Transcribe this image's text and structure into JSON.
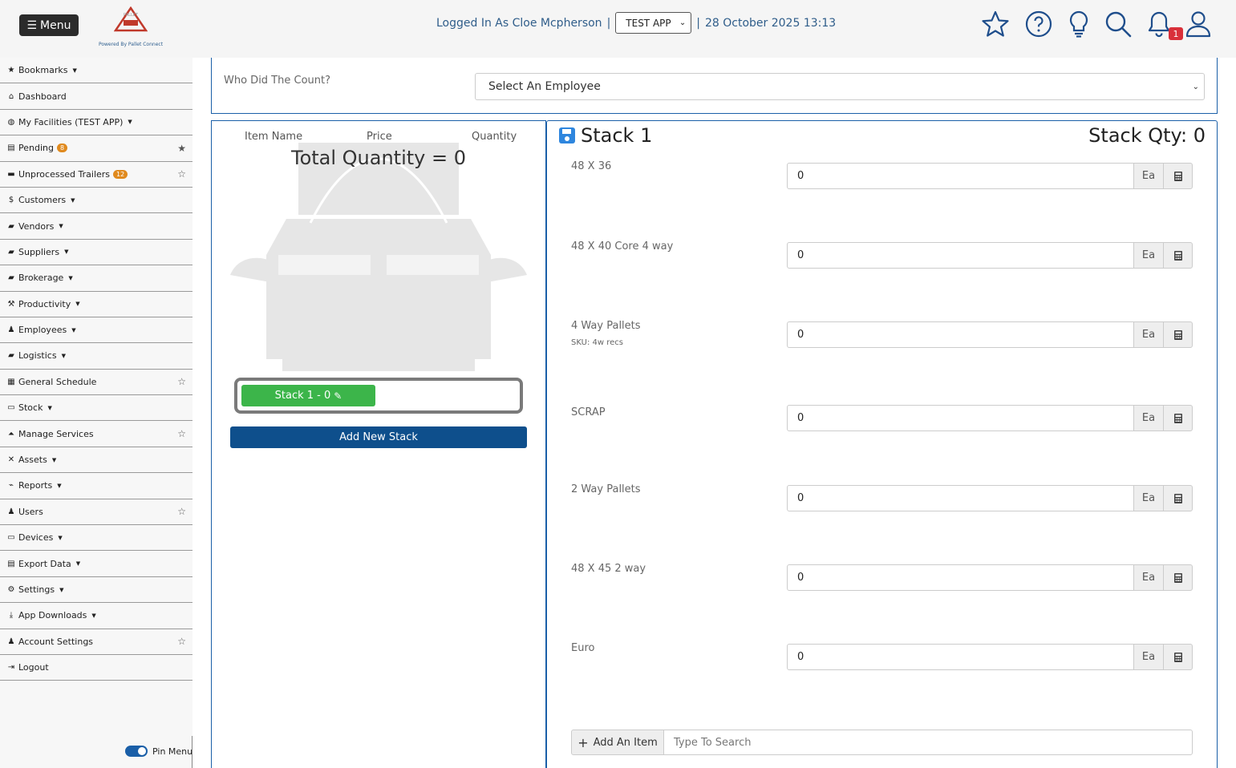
{
  "header": {
    "menu_label": "Menu",
    "logo_sub": "Powered By Pallet Connect",
    "logged_in_text": "Logged In As Cloe Mcpherson",
    "separator": "|",
    "app_select": "TEST APP",
    "datetime": "28 October 2025 13:13",
    "notification_count": "1"
  },
  "sidebar": {
    "items": [
      {
        "label": "Bookmarks",
        "icon": "star-icon",
        "glyph": "★",
        "caret": true
      },
      {
        "label": "Dashboard",
        "icon": "home-icon",
        "glyph": "⌂"
      },
      {
        "label": "My Facilities (TEST APP)",
        "icon": "globe-icon",
        "glyph": "◍",
        "caret": true
      },
      {
        "label": "Pending",
        "icon": "clipboard-icon",
        "glyph": "▤",
        "badge": "8",
        "star": "★"
      },
      {
        "label": "Unprocessed Trailers",
        "icon": "trailer-icon",
        "glyph": "▬",
        "badge": "12",
        "star": "☆"
      },
      {
        "label": "Customers",
        "icon": "dollar-icon",
        "glyph": "$",
        "caret": true
      },
      {
        "label": "Vendors",
        "icon": "truck-icon",
        "glyph": "▰",
        "caret": true
      },
      {
        "label": "Suppliers",
        "icon": "truck-icon",
        "glyph": "▰",
        "caret": true
      },
      {
        "label": "Brokerage",
        "icon": "truck-fast-icon",
        "glyph": "▰",
        "caret": true
      },
      {
        "label": "Productivity",
        "icon": "hammer-icon",
        "glyph": "⚒",
        "caret": true
      },
      {
        "label": "Employees",
        "icon": "person-icon",
        "glyph": "♟",
        "caret": true
      },
      {
        "label": "Logistics",
        "icon": "truck-icon",
        "glyph": "▰",
        "caret": true
      },
      {
        "label": "General Schedule",
        "icon": "calendar-icon",
        "glyph": "▦",
        "star": "☆"
      },
      {
        "label": "Stock",
        "icon": "pallet-icon",
        "glyph": "▭",
        "caret": true
      },
      {
        "label": "Manage Services",
        "icon": "bell-service-icon",
        "glyph": "⏶",
        "star": "☆"
      },
      {
        "label": "Assets",
        "icon": "tools-icon",
        "glyph": "✕",
        "caret": true
      },
      {
        "label": "Reports",
        "icon": "chart-line-icon",
        "glyph": "⌁",
        "caret": true
      },
      {
        "label": "Users",
        "icon": "users-icon",
        "glyph": "♟",
        "star": "☆"
      },
      {
        "label": "Devices",
        "icon": "desktop-icon",
        "glyph": "▭",
        "caret": true
      },
      {
        "label": "Export Data",
        "icon": "file-export-icon",
        "glyph": "▤",
        "caret": true
      },
      {
        "label": "Settings",
        "icon": "gears-icon",
        "glyph": "⚙",
        "caret": true
      },
      {
        "label": "App Downloads",
        "icon": "download-icon",
        "glyph": "⤓",
        "caret": true
      },
      {
        "label": "Account Settings",
        "icon": "user-icon",
        "glyph": "♟",
        "star": "☆"
      },
      {
        "label": "Logout",
        "icon": "logout-icon",
        "glyph": "⇥"
      }
    ],
    "pin_menu_label": "Pin Menu"
  },
  "count": {
    "label": "Who Did The Count?",
    "employee_select": "Select An Employee"
  },
  "left_panel": {
    "col_item_name": "Item Name",
    "col_price": "Price",
    "col_quantity": "Quantity",
    "total_quantity": "Total Quantity = 0",
    "stack_pill": "Stack 1 - 0",
    "add_stack_label": "Add New Stack"
  },
  "right_panel": {
    "stack_title": "Stack 1",
    "stack_qty": "Stack Qty: 0",
    "items": [
      {
        "name": "48 X 36",
        "sku": "",
        "value": "0",
        "unit": "Ea"
      },
      {
        "name": "48 X 40 Core 4 way",
        "sku": "",
        "value": "0",
        "unit": "Ea"
      },
      {
        "name": "4 Way Pallets",
        "sku": "SKU: 4w recs",
        "value": "0",
        "unit": "Ea"
      },
      {
        "name": "SCRAP",
        "sku": "",
        "value": "0",
        "unit": "Ea"
      },
      {
        "name": "2 Way Pallets",
        "sku": "",
        "value": "0",
        "unit": "Ea"
      },
      {
        "name": "48 X 45 2 way",
        "sku": "",
        "value": "0",
        "unit": "Ea"
      },
      {
        "name": "Euro",
        "sku": "",
        "value": "0",
        "unit": "Ea"
      }
    ],
    "add_item_label": "Add An Item",
    "search_placeholder": "Type To Search"
  },
  "colors": {
    "primary": "#1a5fa8",
    "success": "#3cb54a",
    "dark_button": "#0e4f8c",
    "notification": "#d9303a"
  }
}
